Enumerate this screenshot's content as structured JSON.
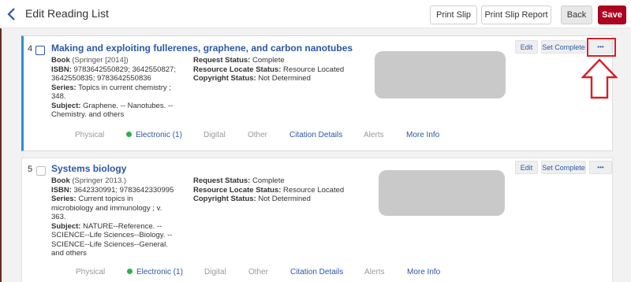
{
  "header": {
    "title": "Edit Reading List",
    "buttons": {
      "print_slip": "Print Slip",
      "print_slip_report": "Print Slip Report",
      "back": "Back",
      "save": "Save"
    }
  },
  "items": [
    {
      "number": "4",
      "title": "Making and exploiting fullerenes, graphene, and carbon nanotubes",
      "type_label": "Book",
      "type_detail": "(Springer [2014])",
      "isbn_label": "ISBN:",
      "isbn_lines": [
        "9783642550829; 3642550827;",
        "3642550835; 9783642550836"
      ],
      "series_label": "Series:",
      "series_lines": [
        "Topics in current chemistry ;",
        "348."
      ],
      "subject_label": "Subject:",
      "subject_lines": [
        "Graphene. -- Nanotubes. --",
        "Chemistry. and others"
      ],
      "request_status_label": "Request Status:",
      "request_status": "Complete",
      "resource_locate_label": "Resource Locate Status:",
      "resource_locate": "Resource Located",
      "copyright_label": "Copyright Status:",
      "copyright": "Not Determined",
      "actions": {
        "edit": "Edit",
        "set_complete": "Set Complete",
        "more": "•••"
      },
      "tabs": {
        "physical": "Physical",
        "electronic": "Electronic (1)",
        "digital": "Digital",
        "other": "Other",
        "citation_details": "Citation Details",
        "alerts": "Alerts",
        "more_info": "More Info"
      }
    },
    {
      "number": "5",
      "title": "Systems biology",
      "type_label": "Book",
      "type_detail": "(Springer 2013.)",
      "isbn_label": "ISBN:",
      "isbn_lines": [
        "3642330991; 9783642330995"
      ],
      "series_label": "Series:",
      "series_lines": [
        "Current topics in",
        "microbiology and immunology ; v.",
        "363."
      ],
      "subject_label": "Subject:",
      "subject_lines": [
        "NATURE--Reference. --",
        "SCIENCE--Life Sciences--Biology. --",
        "SCIENCE--Life Sciences--General.",
        "and others"
      ],
      "request_status_label": "Request Status:",
      "request_status": "Complete",
      "resource_locate_label": "Resource Locate Status:",
      "resource_locate": "Resource Located",
      "copyright_label": "Copyright Status:",
      "copyright": "Not Determined",
      "actions": {
        "edit": "Edit",
        "set_complete": "Set Complete",
        "more": "•••"
      },
      "tabs": {
        "physical": "Physical",
        "electronic": "Electronic (1)",
        "digital": "Digital",
        "other": "Other",
        "citation_details": "Citation Details",
        "alerts": "Alerts",
        "more_info": "More Info"
      }
    }
  ],
  "icons": {
    "back": "chevron-left-icon",
    "more": "more-options-icon",
    "status": "green-dot-icon",
    "annotation": "up-arrow-icon"
  },
  "colors": {
    "link": "#2c57a8",
    "accent": "#2a8fd6",
    "save": "#b1001f",
    "annotation": "#d61f26",
    "available": "#2bb34a"
  }
}
